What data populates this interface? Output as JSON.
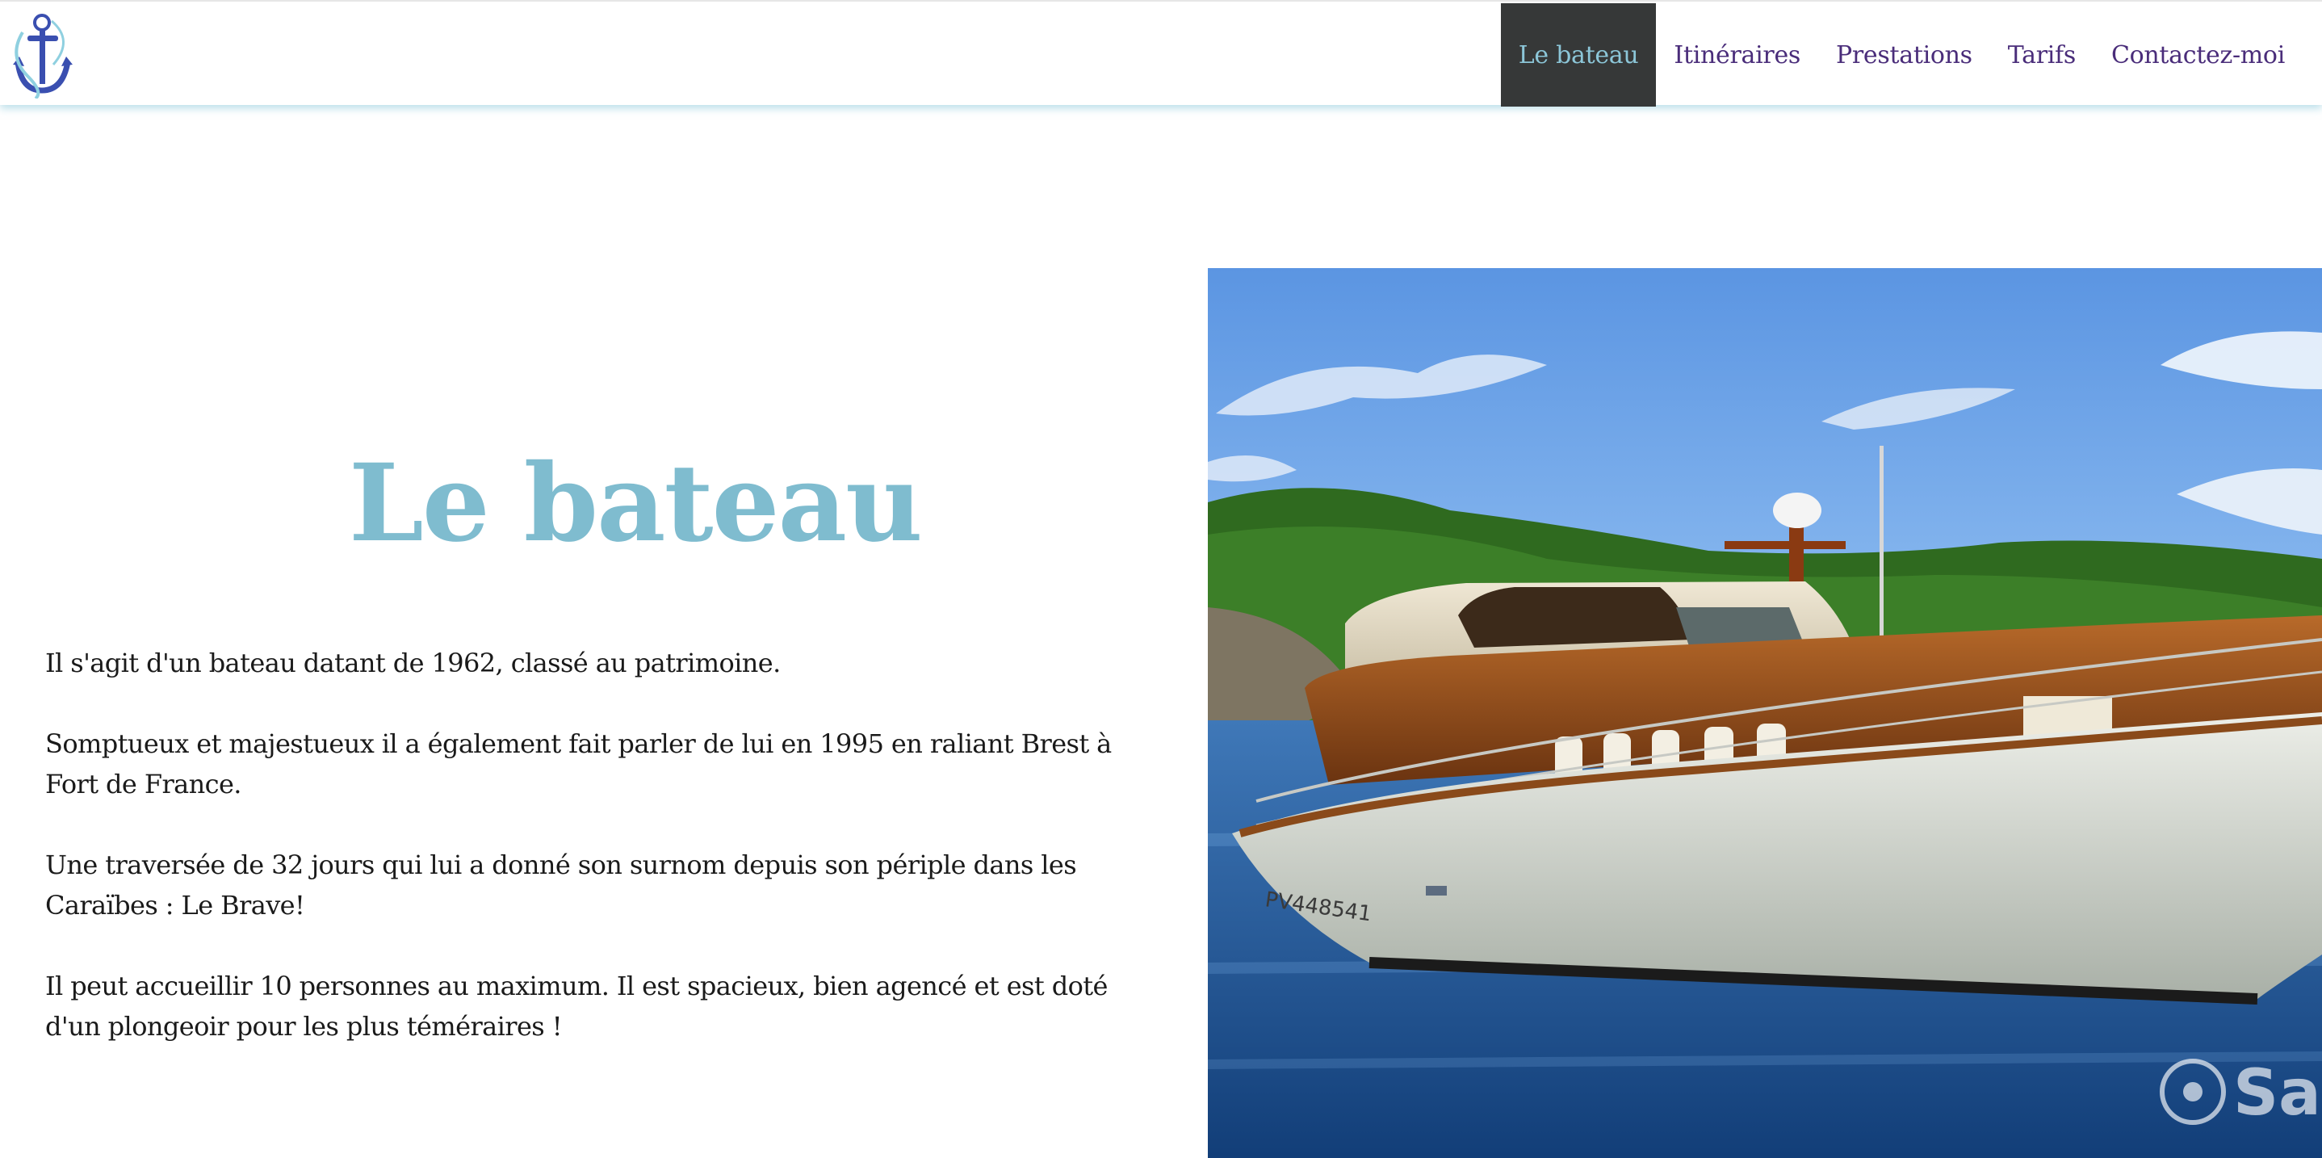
{
  "nav": {
    "items": [
      {
        "label": "Le bateau",
        "active": true
      },
      {
        "label": "Itinéraires",
        "active": false
      },
      {
        "label": "Prestations",
        "active": false
      },
      {
        "label": "Tarifs",
        "active": false
      },
      {
        "label": "Contactez-moi",
        "active": false
      }
    ]
  },
  "logo": {
    "icon": "anchor-icon"
  },
  "main": {
    "title": "Le bateau",
    "paragraphs": [
      "Il s'agit d'un bateau datant de 1962, classé au patrimoine.",
      "Somptueux et majestueux il a également fait parler de lui en 1995 en raliant Brest à Fort de France.",
      "Une traversée de 32 jours qui lui a donné son surnom depuis son périple dans les Caraïbes : Le Brave!",
      "Il peut accueillir 10 personnes au maximum. Il est spacieux, bien agencé et est doté d'un plongeoir pour les plus téméraires !"
    ]
  },
  "photo": {
    "hull_text": "PV448541",
    "watermark": "Sa"
  },
  "colors": {
    "accent": "#7fbccf",
    "nav_text": "#4a2d7a",
    "nav_active_bg": "#363838",
    "nav_active_text": "#8cc6d8"
  }
}
